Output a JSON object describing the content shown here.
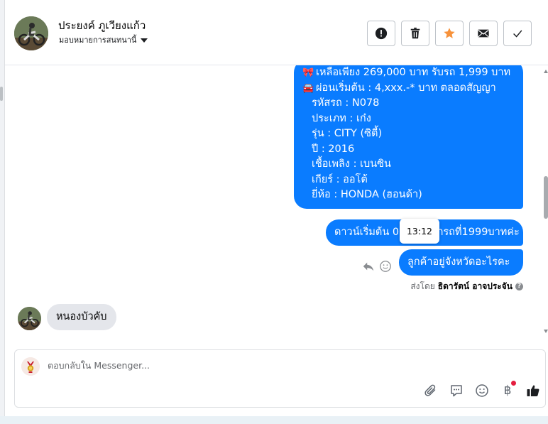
{
  "header": {
    "contact_name": "ประยงค์ ภูเวียงแก้ว",
    "assign_label": "มอบหมายการสนทนานี้",
    "buttons": [
      {
        "name": "alert-button",
        "icon": "alert-circle-icon"
      },
      {
        "name": "trash-button",
        "icon": "trash-icon"
      },
      {
        "name": "star-button",
        "icon": "star-icon"
      },
      {
        "name": "mail-button",
        "icon": "envelope-icon"
      },
      {
        "name": "done-button",
        "icon": "checkmark-icon"
      }
    ]
  },
  "messages": {
    "big_bubble": {
      "line1": "เหลือเพียง 269,000 บาท รับรถ 1,999 บาท",
      "line2": "ผ่อนเริ่มต้น : 4,xxx.-* บาท ตลอดสัญญา",
      "details": [
        "รหัสรถ : N078",
        "ประเภท : เก๋ง",
        "รุ่น : CITY (ซิตี้)",
        "ปี : 2016",
        "เชื้อเพลิง : เบนซิน",
        "เกียร์ : ออโต้",
        "ยี่ห้อ : HONDA (ฮอนด้า)"
      ]
    },
    "bubble1": "ดาวน์เริ่มต้น 0 บาท ออกรถที่1999บาทค่ะ",
    "tooltip_time": "13:12",
    "bubble2": "ลูกค้าอยู่จังหวัดอะไรคะ",
    "sent_by_label": "ส่งโดย",
    "sent_by_agent": "ธิดารัตน์ อาจประจัน",
    "incoming": "หนองบัวคับ"
  },
  "composer": {
    "placeholder": "ตอบกลับใน Messenger...",
    "tools": [
      "paperclip-icon",
      "chat-bubble-icon",
      "smiley-icon",
      "baht-icon",
      "thumbs-up-icon"
    ],
    "baht_symbol": "฿"
  },
  "colors": {
    "bubble_blue": "#0a7cff",
    "incoming_gray": "#e4e6eb",
    "star_orange": "#f7923b",
    "notification_red": "#e41e3f"
  }
}
